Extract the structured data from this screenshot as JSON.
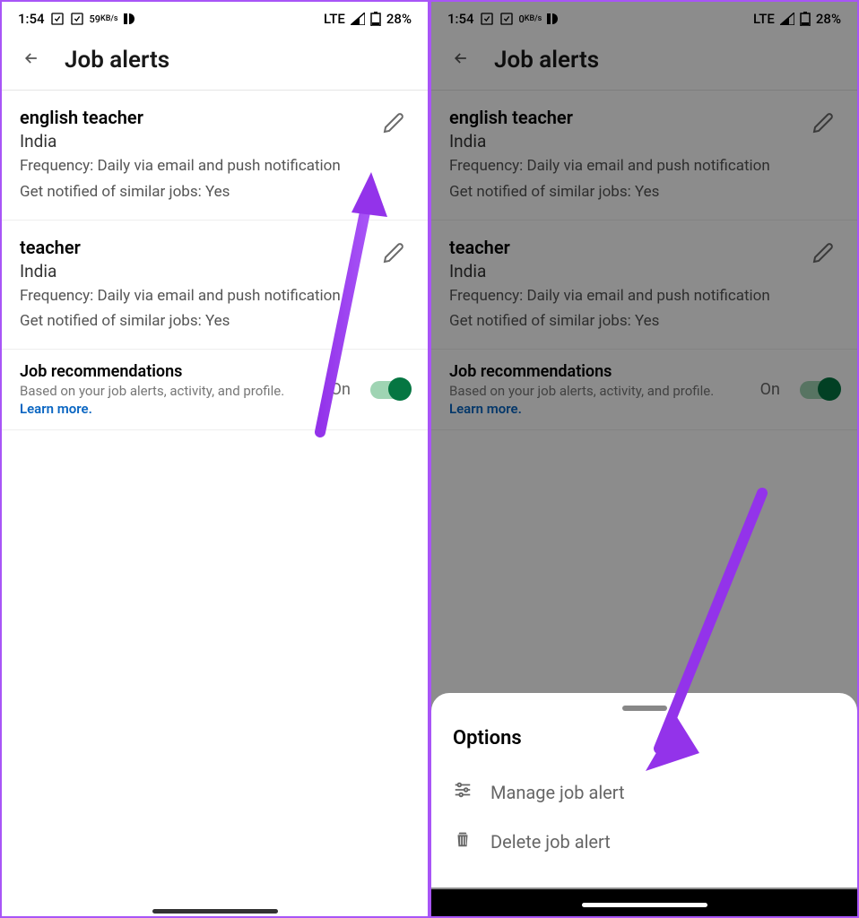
{
  "status": {
    "time": "1:54",
    "speed1": "59",
    "speed2": "0",
    "speedUnit": "KB/s",
    "network": "LTE",
    "battery": "28%"
  },
  "header": {
    "title": "Job alerts"
  },
  "alerts": [
    {
      "title": "english teacher",
      "location": "India",
      "frequency": "Frequency: Daily via email and push notification",
      "similar": "Get notified of similar jobs: Yes"
    },
    {
      "title": "teacher",
      "location": "India",
      "frequency": "Frequency: Daily via email and push notification",
      "similar": "Get notified of similar jobs: Yes"
    }
  ],
  "recommendations": {
    "title": "Job recommendations",
    "subtitle": "Based on your job alerts, activity, and profile.",
    "learnMore": "Learn more.",
    "status": "On"
  },
  "sheet": {
    "title": "Options",
    "manage": "Manage job alert",
    "delete": "Delete job alert"
  }
}
